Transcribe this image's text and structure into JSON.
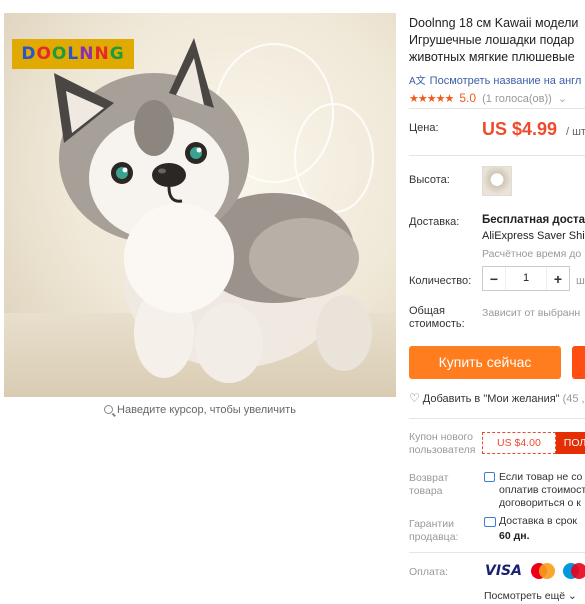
{
  "brand_logo": {
    "text": "DOOLNNG",
    "letters": [
      {
        "ch": "D",
        "color": "#2a55c9"
      },
      {
        "ch": "O",
        "color": "#e52a2a"
      },
      {
        "ch": "O",
        "color": "#1e9b3c"
      },
      {
        "ch": "L",
        "color": "#2a55c9"
      },
      {
        "ch": "N",
        "color": "#8a2fb5"
      },
      {
        "ch": "N",
        "color": "#e52a2a"
      },
      {
        "ch": "G",
        "color": "#1e9b3c"
      }
    ]
  },
  "zoom_hint": "Наведите курсор, чтобы увеличить",
  "product": {
    "title_lines": [
      "Doolnng 18 см Kawaii модели",
      "Игрушечные лошадки подар",
      "животных мягкие плюшевые"
    ],
    "translate_link": "Посмотреть название на англ",
    "rating": {
      "stars": "★★★★★",
      "value": "5.0",
      "count": "(1 голоса(ов))"
    }
  },
  "price": {
    "label": "Цена:",
    "value": "US $4.99",
    "unit": "/ шт"
  },
  "height": {
    "label": "Высота:"
  },
  "shipping": {
    "label": "Доставка:",
    "main": "Бесплатная доставк",
    "method": "AliExpress Saver Shi",
    "estimate": "Расчётное время до"
  },
  "quantity": {
    "label": "Количество:",
    "value": "1",
    "minus": "−",
    "plus": "+",
    "unit": "ш"
  },
  "total": {
    "label": "Общая стоимость:",
    "note": "Зависит от выбранн"
  },
  "buttons": {
    "buy_now": "Купить сейчас"
  },
  "wishlist": {
    "label": "Добавить в \"Мои желания\"",
    "count": "(45 ,"
  },
  "coupon": {
    "label": "Купон нового пользователя",
    "amount": "US $4.00",
    "get": "ПОЛ"
  },
  "returns": {
    "label": "Возврат товара",
    "lines": [
      "Если товар не со",
      "оплатив стоимост",
      "договориться о к"
    ]
  },
  "guarantee": {
    "label": "Гарантии продавца:",
    "text": "Доставка в срок",
    "days": "60 дн."
  },
  "payment": {
    "label": "Оплата:",
    "visa": "VISA",
    "more": "Посмотреть ещё"
  },
  "colors": {
    "accent": "#f04a2c",
    "buy_button": "#ff7d1f",
    "link": "#3b5ea5"
  }
}
